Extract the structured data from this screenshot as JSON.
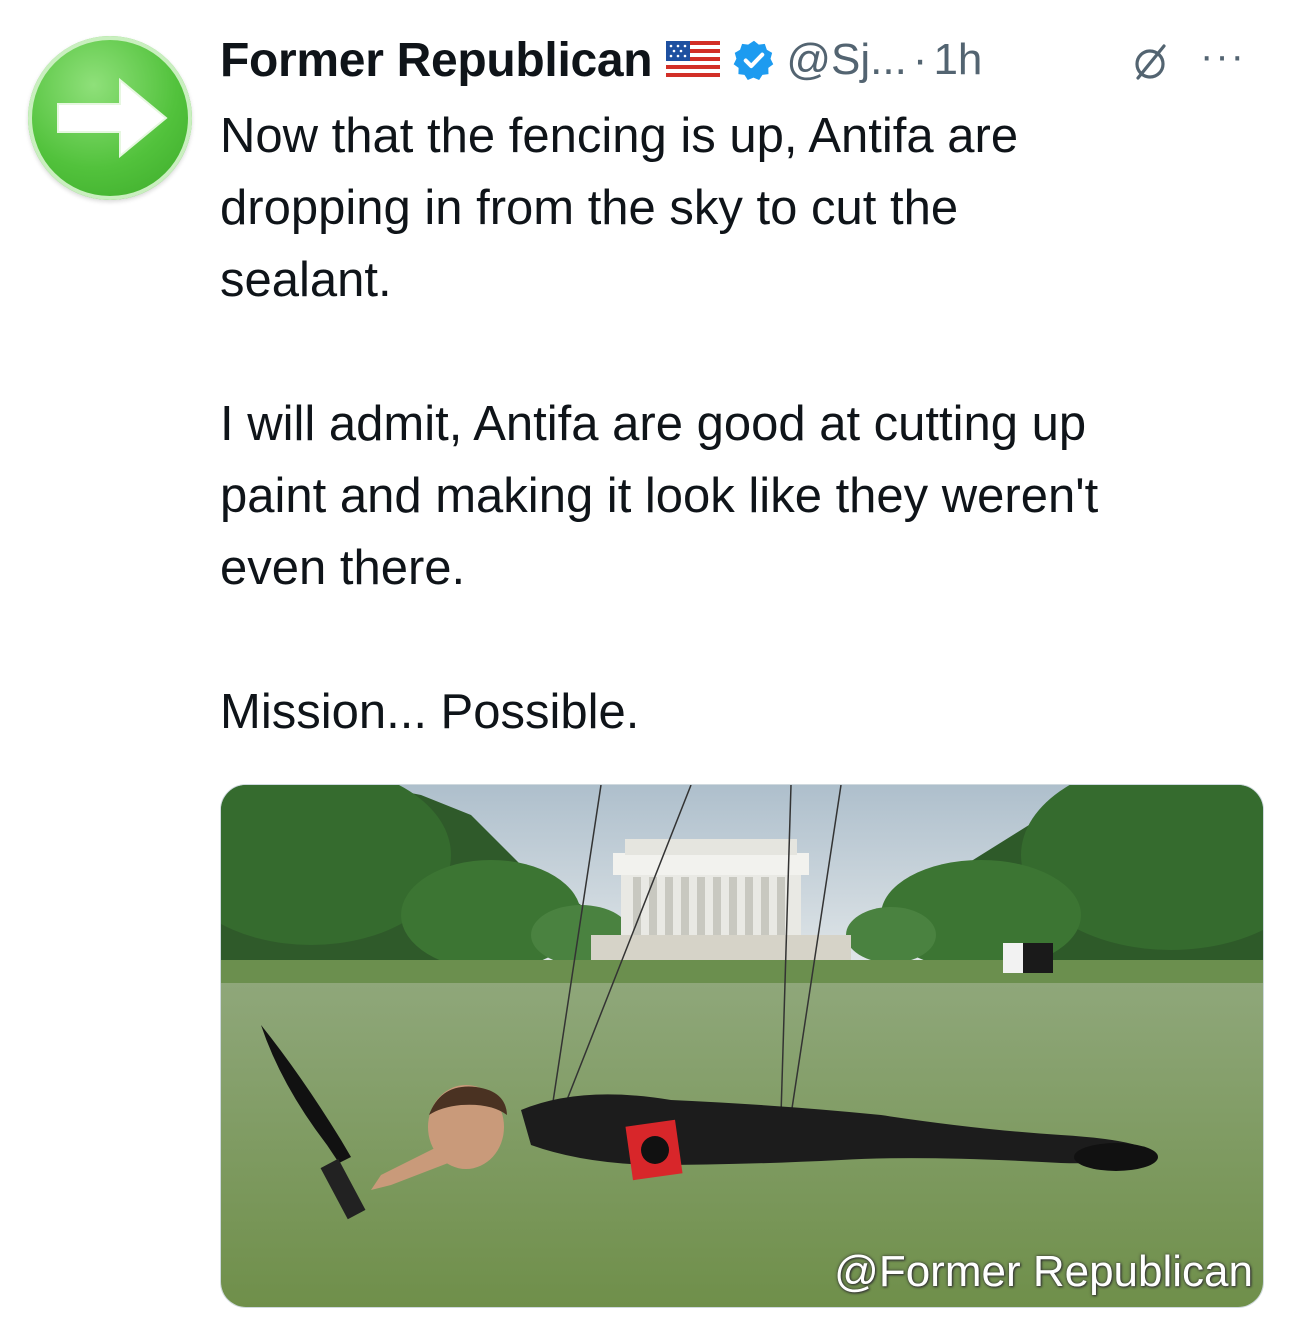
{
  "author": {
    "display_name": "Former Republican",
    "handle": "@Sj...",
    "separator": "·",
    "time": "1h",
    "avatar_icon": "green-right-arrow-icon",
    "flag_icon": "us-flag-icon",
    "verified_icon": "verified-badge-icon",
    "verified_color": "#1d9bf0"
  },
  "actions": {
    "grok_icon": "grok-icon",
    "more_label": "···"
  },
  "tweet": {
    "text": "Now that the fencing is up, Antifa are\ndropping in from the sky to cut the\nsealant.\n\nI will admit, Antifa are good at cutting up\npaint and making it look like they weren't\neven there.\n\nMission... Possible."
  },
  "media": {
    "watermark": "@Former Republican",
    "description_icon": "photo-reflecting-pool-memorial"
  },
  "colors": {
    "text": "#0f1419",
    "secondary": "#536471",
    "avatar_green": "#52c23c"
  }
}
